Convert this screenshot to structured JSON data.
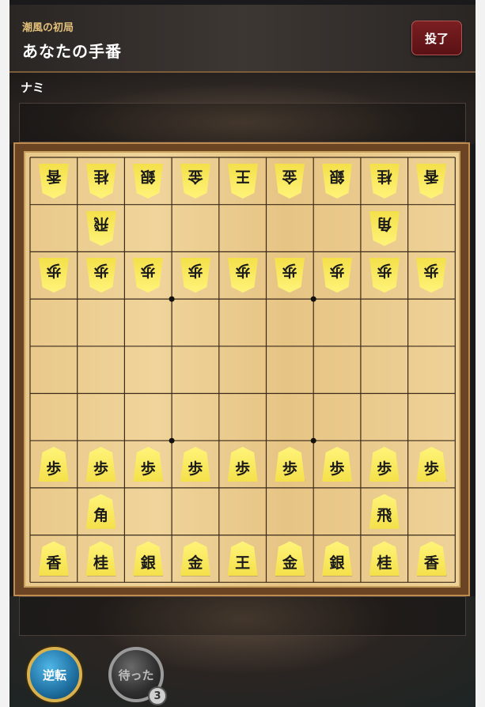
{
  "header": {
    "subtitle": "潮風の初局",
    "title": "あなたの手番",
    "resign_label": "投了"
  },
  "opponent": {
    "name": "ナミ"
  },
  "board": {
    "gote": [
      {
        "ch": "香",
        "col": 0,
        "row": 0
      },
      {
        "ch": "桂",
        "col": 1,
        "row": 0
      },
      {
        "ch": "銀",
        "col": 2,
        "row": 0
      },
      {
        "ch": "金",
        "col": 3,
        "row": 0
      },
      {
        "ch": "王",
        "col": 4,
        "row": 0
      },
      {
        "ch": "金",
        "col": 5,
        "row": 0
      },
      {
        "ch": "銀",
        "col": 6,
        "row": 0
      },
      {
        "ch": "桂",
        "col": 7,
        "row": 0
      },
      {
        "ch": "香",
        "col": 8,
        "row": 0
      },
      {
        "ch": "飛",
        "col": 1,
        "row": 1
      },
      {
        "ch": "角",
        "col": 7,
        "row": 1
      },
      {
        "ch": "歩",
        "col": 0,
        "row": 2
      },
      {
        "ch": "歩",
        "col": 1,
        "row": 2
      },
      {
        "ch": "歩",
        "col": 2,
        "row": 2
      },
      {
        "ch": "歩",
        "col": 3,
        "row": 2
      },
      {
        "ch": "歩",
        "col": 4,
        "row": 2
      },
      {
        "ch": "歩",
        "col": 5,
        "row": 2
      },
      {
        "ch": "歩",
        "col": 6,
        "row": 2
      },
      {
        "ch": "歩",
        "col": 7,
        "row": 2
      },
      {
        "ch": "歩",
        "col": 8,
        "row": 2
      }
    ],
    "sente": [
      {
        "ch": "歩",
        "col": 0,
        "row": 6
      },
      {
        "ch": "歩",
        "col": 1,
        "row": 6
      },
      {
        "ch": "歩",
        "col": 2,
        "row": 6
      },
      {
        "ch": "歩",
        "col": 3,
        "row": 6
      },
      {
        "ch": "歩",
        "col": 4,
        "row": 6
      },
      {
        "ch": "歩",
        "col": 5,
        "row": 6
      },
      {
        "ch": "歩",
        "col": 6,
        "row": 6
      },
      {
        "ch": "歩",
        "col": 7,
        "row": 6
      },
      {
        "ch": "歩",
        "col": 8,
        "row": 6
      },
      {
        "ch": "角",
        "col": 1,
        "row": 7
      },
      {
        "ch": "飛",
        "col": 7,
        "row": 7
      },
      {
        "ch": "香",
        "col": 0,
        "row": 8
      },
      {
        "ch": "桂",
        "col": 1,
        "row": 8
      },
      {
        "ch": "銀",
        "col": 2,
        "row": 8
      },
      {
        "ch": "金",
        "col": 3,
        "row": 8
      },
      {
        "ch": "王",
        "col": 4,
        "row": 8
      },
      {
        "ch": "金",
        "col": 5,
        "row": 8
      },
      {
        "ch": "銀",
        "col": 6,
        "row": 8
      },
      {
        "ch": "桂",
        "col": 7,
        "row": 8
      },
      {
        "ch": "香",
        "col": 8,
        "row": 8
      }
    ]
  },
  "controls": {
    "flip_label": "逆転",
    "undo_label": "待った",
    "undo_count": "3"
  },
  "colors": {
    "piece": "#f4e04a",
    "flip_ring": "#d8b24e",
    "resign": "#7a1f22"
  }
}
